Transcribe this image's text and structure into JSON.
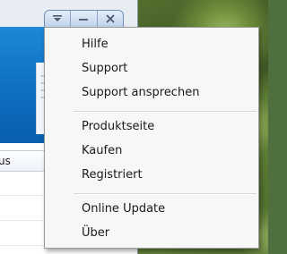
{
  "app": {
    "column_header": "us"
  },
  "title_buttons": {
    "menu_icon": "menu-arrow-icon",
    "minimize_icon": "minimize-icon",
    "close_icon": "close-icon"
  },
  "menu": {
    "items": [
      {
        "label": "Hilfe"
      },
      {
        "label": "Support"
      },
      {
        "label": "Support ansprechen"
      },
      {
        "label": "Produktseite"
      },
      {
        "label": "Kaufen"
      },
      {
        "label": "Registriert"
      },
      {
        "label": "Online Update"
      },
      {
        "label": "Über"
      }
    ]
  },
  "colors": {
    "menu_bg": "#f7f7f7",
    "banner_blue": "#1c88d6",
    "title_button_border": "#6f8fb5"
  }
}
